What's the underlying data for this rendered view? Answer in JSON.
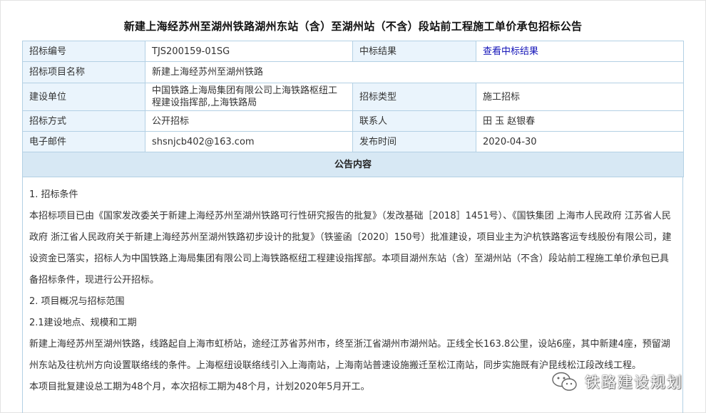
{
  "title": "新建上海经苏州至湖州铁路湖州东站（含）至湖州站（不含）段站前工程施工单价承包招标公告",
  "info": {
    "labels": {
      "bid_no": "招标编号",
      "result": "中标结果",
      "project": "招标项目名称",
      "builder": "建设单位",
      "bid_type": "招标类型",
      "method": "招标方式",
      "contact": "联系人",
      "email": "电子邮件",
      "publish": "发布时间"
    },
    "values": {
      "bid_no": "TJS200159-01SG",
      "result_link": "查看中标结果",
      "project": "新建上海经苏州至湖州铁路",
      "builder": "中国铁路上海局集团有限公司上海铁路枢纽工程建设指挥部,上海铁路局",
      "bid_type": "施工招标",
      "method": "公开招标",
      "contact": "田 玉 赵银春",
      "email": "shsnjcb402@163.com",
      "publish": "2020-04-30"
    },
    "section_header": "公告内容"
  },
  "content": {
    "h1": "1. 招标条件",
    "p1": "本招标项目已由《国家发改委关于新建上海经苏州至湖州铁路可行性研究报告的批复》（发改基础［2018］1451号）、《国铁集团 上海市人民政府 江苏省人民政府 浙江省人民政府关于新建上海经苏州至湖州铁路初步设计的批复》（铁鉴函〔2020〕150号）批准建设，项目业主为沪杭铁路客运专线股份有限公司，建设资金已落实，招标人为中国铁路上海局集团有限公司上海铁路枢纽工程建设指挥部。本项目湖州东站（含）至湖州站（不含）段站前工程施工单价承包已具备招标条件，现进行公开招标。",
    "h2": "2. 项目概况与招标范围",
    "h21": "2.1建设地点、规模和工期",
    "p2": "新建上海经苏州至湖州铁路，线路起自上海市虹桥站，途经江苏省苏州市，终至浙江省湖州市湖州站。正线全长163.8公里，设站6座，其中新建4座，预留湖州东站及往杭州方向设置联络线的条件。上海枢纽设联络线引入上海南站，上海南站普速设施搬迁至松江南站，同步实施既有沪昆线松江段改线工程。",
    "p3": "本项目批复建设总工期为48个月，本次招标工期为48个月，计划2020年5月开工。"
  },
  "watermark": {
    "text": "铁路建设规划",
    "icon": "wechat-icon"
  }
}
